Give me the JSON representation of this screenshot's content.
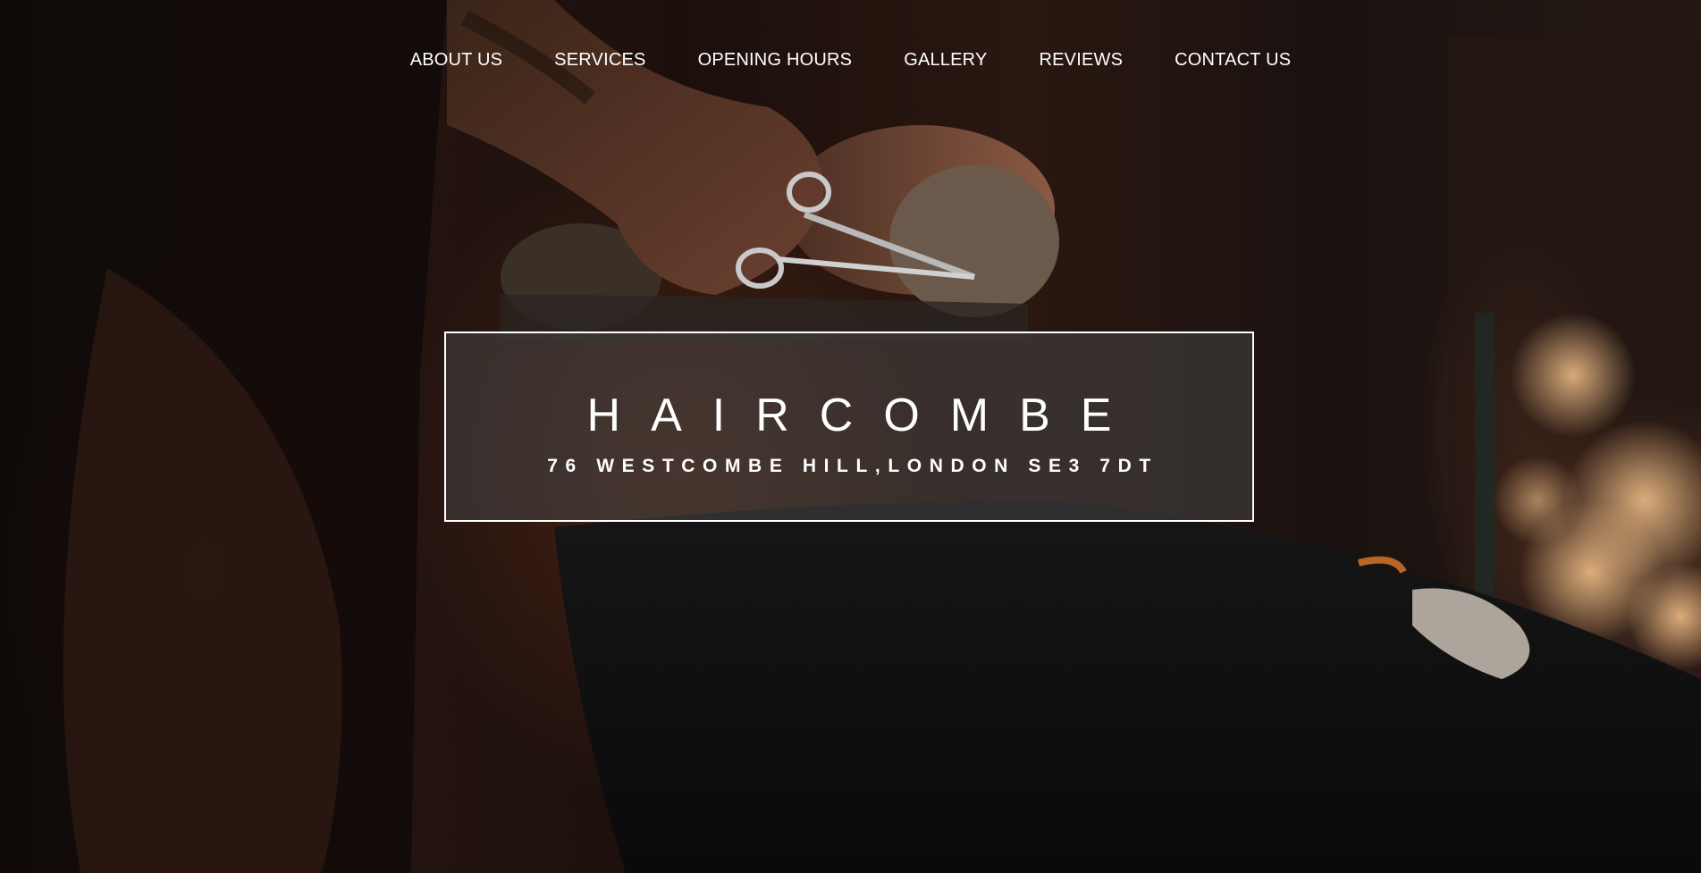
{
  "nav": {
    "items": [
      {
        "label": "ABOUT US"
      },
      {
        "label": "SERVICES"
      },
      {
        "label": "OPENING HOURS"
      },
      {
        "label": "GALLERY"
      },
      {
        "label": "REVIEWS"
      },
      {
        "label": "CONTACT US"
      }
    ]
  },
  "hero": {
    "title": "HAIRCOMBE",
    "address": "76 WESTCOMBE HILL,LONDON SE3 7DT",
    "background_image": "barber-trimming-beard-photo"
  },
  "colors": {
    "text": "#ffffff",
    "box_border": "#ffffff",
    "box_fill": "#464646",
    "background": "#0e0c0a"
  }
}
